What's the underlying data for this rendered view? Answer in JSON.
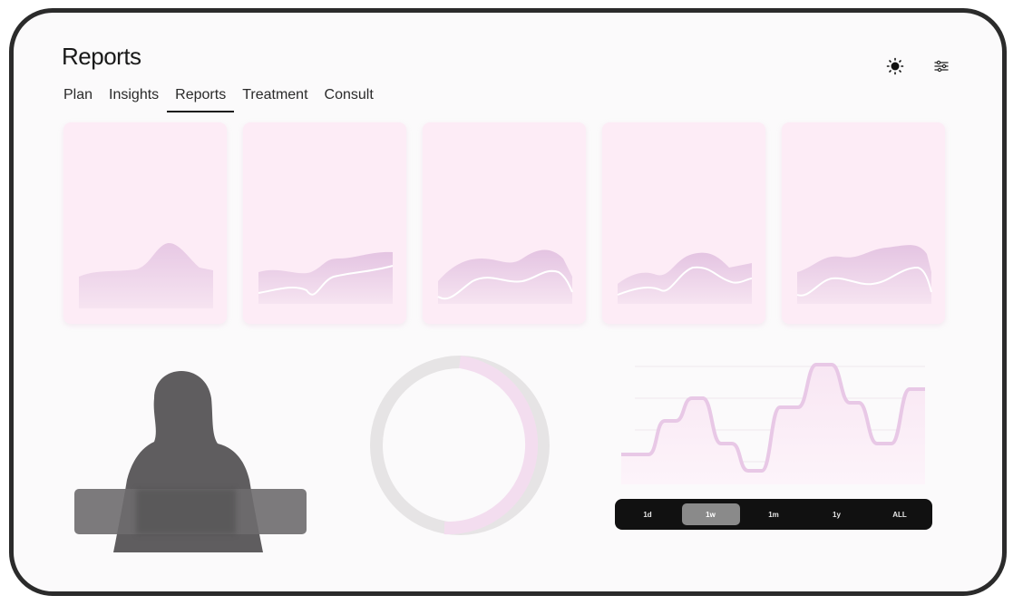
{
  "header": {
    "title": "Reports"
  },
  "tabs": [
    {
      "label": "Plan"
    },
    {
      "label": "Insights"
    },
    {
      "label": "Reports",
      "active": true
    },
    {
      "label": "Treatment"
    },
    {
      "label": "Consult"
    }
  ],
  "header_icons": [
    "sun-icon",
    "filter-icon"
  ],
  "range_selector": {
    "options": [
      "1d",
      "1w",
      "1m",
      "1y",
      "ALL"
    ],
    "selected": "1w"
  },
  "colors": {
    "card_bg": "#fdecf6",
    "accent_pink": "#e8c8e6",
    "range_bar_bg": "#111111",
    "silhouette": "#5f5d5f"
  }
}
